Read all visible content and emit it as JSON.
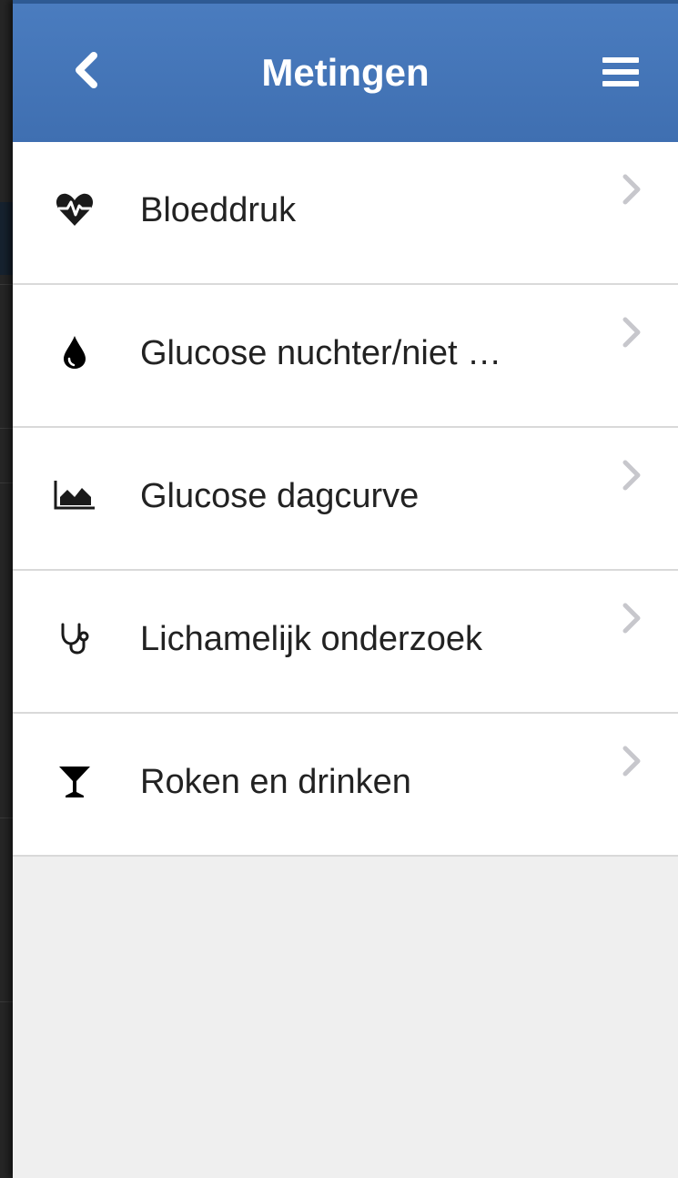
{
  "header": {
    "title": "Metingen",
    "back_icon": "chevron-left-icon",
    "menu_icon": "hamburger-menu-icon",
    "background_color": "#4477b8"
  },
  "list": {
    "items": [
      {
        "label": "Bloeddruk",
        "icon": "heartbeat-icon"
      },
      {
        "label": "Glucose nuchter/niet …",
        "icon": "drop-icon"
      },
      {
        "label": "Glucose dagcurve",
        "icon": "area-chart-icon"
      },
      {
        "label": "Lichamelijk onderzoek",
        "icon": "stethoscope-icon"
      },
      {
        "label": "Roken en drinken",
        "icon": "cocktail-glass-icon"
      }
    ],
    "chevron_icon": "chevron-right-icon"
  },
  "colors": {
    "accent": "#4477b8",
    "list_background": "#ffffff",
    "empty_area": "#efefef",
    "chevron": "#c7c7cc"
  }
}
